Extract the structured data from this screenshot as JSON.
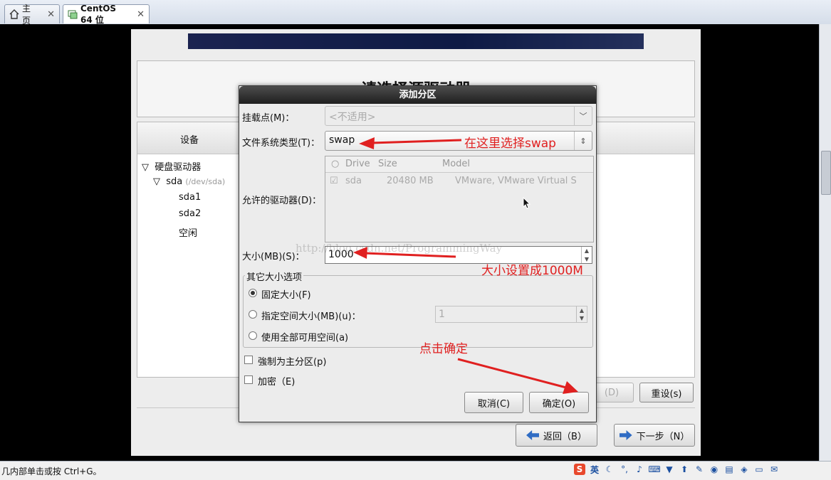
{
  "tabs": [
    {
      "label": "主页",
      "icon": "home-icon"
    },
    {
      "label": "CentOS 64 位",
      "icon": "vm-icon"
    }
  ],
  "installer": {
    "title": "请选择源驱动器",
    "device_header": "设备",
    "tree": [
      {
        "label": "硬盘驱动器"
      },
      {
        "label": "sda",
        "sub": "(/dev/sda)"
      },
      {
        "label": "sda1"
      },
      {
        "label": "sda2"
      },
      {
        "label": "空闲"
      }
    ],
    "delete_button": "(D)",
    "reset_button": "重设(s)",
    "back_button": "返回（B）",
    "next_button": "下一步（N）"
  },
  "dialog": {
    "title": "添加分区",
    "mount_label": "挂载点(M)：",
    "mount_value": "<不适用>",
    "fstype_label": "文件系统类型(T)：",
    "fstype_value": "swap",
    "drives_label": "允许的驱动器(D)：",
    "drive_columns": [
      "Drive",
      "Size",
      "Model"
    ],
    "drive_row": {
      "drive": "sda",
      "size": "20480 MB",
      "model": "VMware, VMware Virtual S",
      "checked": true
    },
    "size_label": "大小(MB)(S)：",
    "size_value": "1000",
    "other_options_label": "其它大小选项",
    "option_fixed": "固定大小(F)",
    "option_max": "指定空间大小(MB)(u)：",
    "option_max_value": "1",
    "option_fill": "使用全部可用空间(a)",
    "selected_option": "fixed",
    "primary_label": "強制为主分区(p)",
    "encrypt_label": "加密（E)",
    "cancel_button": "取消(C)",
    "ok_button": "确定(O)"
  },
  "annotations": {
    "select_swap": "在这里选择swap",
    "set_size": "大小设置成1000M",
    "click_ok": "点击确定",
    "color": "#e02020"
  },
  "watermark": "http://blog.csdn.net/ProgrammingWay",
  "status": {
    "text": "几内部单击或按 Ctrl+G。",
    "tray": [
      "sogou-icon",
      "英",
      "moon-icon",
      "punct-icon",
      "mic-icon",
      "keyboard-icon",
      "shirt-icon",
      "upload-icon",
      "wrench-icon",
      "network-icon",
      "printer-icon",
      "sound-icon",
      "storage-icon",
      "message-icon"
    ]
  }
}
